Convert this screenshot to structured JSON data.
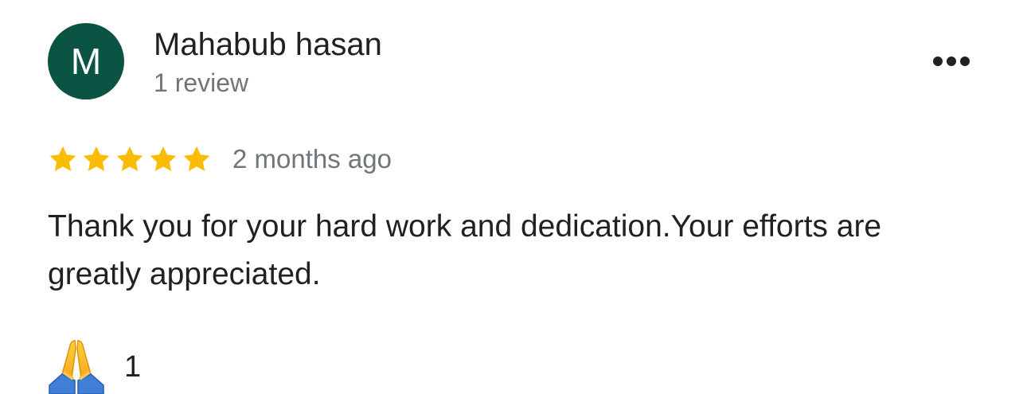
{
  "reviewer": {
    "initial": "M",
    "name": "Mahabub hasan",
    "review_count": "1 review",
    "avatar_color": "#0b5443"
  },
  "menu": {
    "icon": "more-horizontal-icon"
  },
  "rating": {
    "stars": 5,
    "max_stars": 5,
    "star_color": "#fbbc04",
    "time": "2 months ago"
  },
  "review": {
    "text": "Thank you for your hard work and dedication.Your efforts are greatly appreciated."
  },
  "reaction": {
    "icon": "folded-hands-icon",
    "count": "1"
  }
}
